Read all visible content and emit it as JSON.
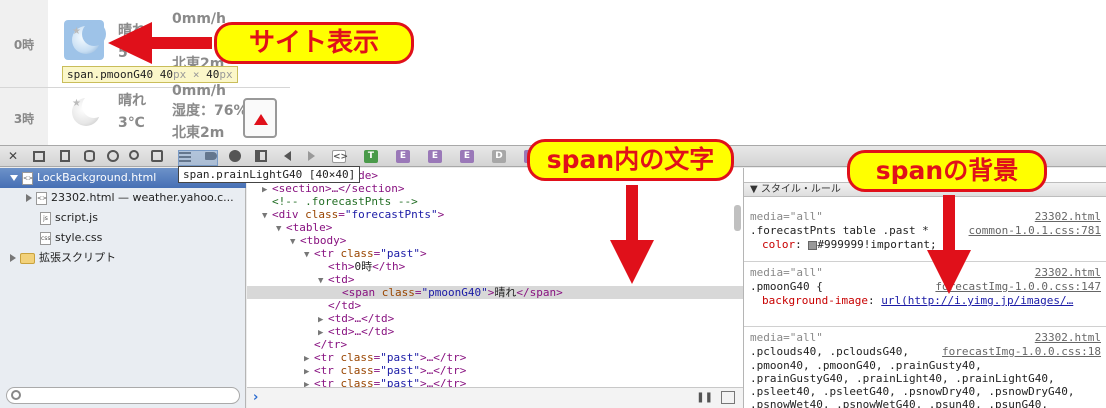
{
  "weather": {
    "rows": [
      {
        "hour": "0時",
        "condition": "晴れ",
        "temp": "5",
        "precip": "0mm/h",
        "wind": "北東2m"
      },
      {
        "hour": "3時",
        "condition": "晴れ",
        "temp": "3℃",
        "precip": "0mm/h",
        "humidity": "湿度：76%",
        "wind": "北東2m"
      }
    ],
    "tooltip": {
      "name": "span.pmoonG40",
      "w": "40",
      "h": "40",
      "unit": "px",
      "times": "×"
    }
  },
  "devtools": {
    "toolbar": {
      "close": "✕",
      "breadcrumb_tag": "E",
      "breadcrumb_doc": "<>",
      "breadcrumb_D": "D"
    },
    "selection_tooltip": "span.prainLightG40 [40×40]",
    "sidebar": {
      "items": [
        {
          "label": "LockBackground.html"
        },
        {
          "label": "23302.html — weather.yahoo.c..."
        },
        {
          "label": "script.js",
          "type": "js"
        },
        {
          "label": "style.css",
          "type": "css"
        },
        {
          "label": "拡張スクリプト"
        }
      ]
    },
    "elements": {
      "lines": [
        {
          "indent": 9,
          "text": "▶",
          "tag": "<aside>…</aside>"
        },
        {
          "indent": 9,
          "text": "▶",
          "tag": "<section>…</section>"
        },
        {
          "indent": 9,
          "text": "",
          "comment": "<!-- .forecastPnts -->"
        },
        {
          "indent": 9,
          "text": "▼",
          "tag": "<div ",
          "attr": "class",
          "val": "\"forecastPnts\"",
          "end": ">"
        },
        {
          "indent": 11,
          "text": "▼",
          "tag": "<table>"
        },
        {
          "indent": 13,
          "text": "▼",
          "tag": "<tbody>"
        },
        {
          "indent": 15,
          "text": "▼",
          "tag": "<tr ",
          "attr": "class",
          "val": "\"past\"",
          "end": ">"
        },
        {
          "indent": 17,
          "text": "",
          "tag": "<th>",
          "inner": "0時",
          "close": "</th>"
        },
        {
          "indent": 17,
          "text": "▼",
          "tag": "<td>"
        },
        {
          "indent": 19,
          "text": "",
          "tag": "<span ",
          "attr": "class",
          "val": "\"pmoonG40\"",
          "end": ">",
          "inner": "晴れ",
          "close": "</span>",
          "highlight": true
        },
        {
          "indent": 17,
          "text": "",
          "tag": "</td>"
        },
        {
          "indent": 17,
          "text": "▶",
          "tag": "<td>…</td>"
        },
        {
          "indent": 17,
          "text": "▶",
          "tag": "<td>…</td>"
        },
        {
          "indent": 15,
          "text": "",
          "tag": "</tr>"
        },
        {
          "indent": 15,
          "text": "▶",
          "tag": "<tr ",
          "attr": "class",
          "val": "\"past\"",
          "end": ">…</tr>"
        },
        {
          "indent": 15,
          "text": "▶",
          "tag": "<tr ",
          "attr": "class",
          "val": "\"past\"",
          "end": ">…</tr>"
        },
        {
          "indent": 15,
          "text": "▶",
          "tag": "<tr ",
          "attr": "class",
          "val": "\"past\"",
          "end": ">…</tr>"
        }
      ]
    },
    "console_prompt": "›",
    "styles": {
      "header": "▼ スタイル・ルール",
      "rules": [
        {
          "media": "media=\"all\"",
          "source_page": "23302.html",
          "selector": ".forecastPnts table .past *",
          "source": "common-1.0.1.css:781",
          "prop": "color",
          "value": "#999999!important;",
          "swatch": "#999999"
        },
        {
          "media": "media=\"all\"",
          "source_page": "23302.html",
          "selector": ".pmoonG40 {",
          "source": "forecastImg-1.0.0.css:147",
          "prop": "background-image",
          "value": "url(http://i.yimg.jp/images/…"
        },
        {
          "media": "media=\"all\"",
          "source_page": "23302.html",
          "selector": ".pclouds40, .pcloudsG40,",
          "source": "forecastImg-1.0.0.css:18",
          "more": [
            ".pmoon40, .pmoonG40, .prainGusty40,",
            ".prainGustyG40, .prainLight40, .prainLightG40,",
            ".psleet40, .psleetG40, .psnowDry40, .psnowDryG40,",
            ".psnowWet40, .psnowWetG40, .psun40, .psunG40,"
          ]
        }
      ]
    }
  },
  "annotations": {
    "site_display": "サイト表示",
    "span_text": "span内の文字",
    "span_bg": "spanの背景"
  },
  "colors": {
    "callout_fill": "#ffff00",
    "callout_red": "#e0101a",
    "selection": "#466fb4"
  }
}
